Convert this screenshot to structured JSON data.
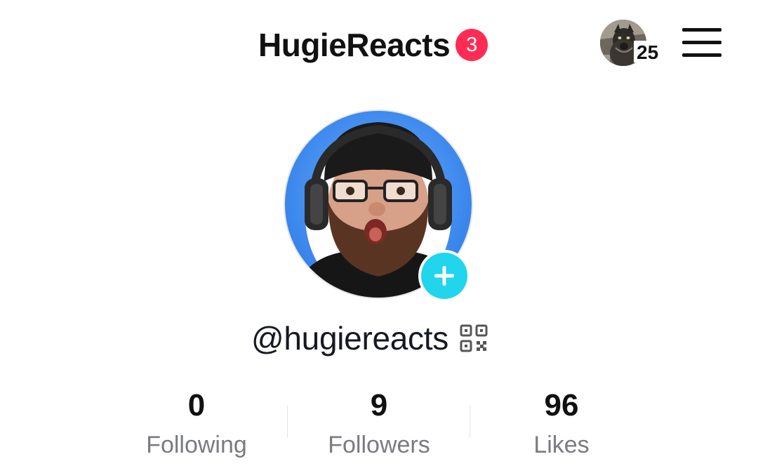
{
  "header": {
    "title": "HugieReacts",
    "notification_count": "3",
    "switch_account_count": "25"
  },
  "icons": {
    "menu": "hamburger-menu-icon",
    "add": "plus-icon",
    "qr": "qr-code-icon"
  },
  "profile": {
    "username": "@hugiereacts"
  },
  "stats": {
    "following_value": "0",
    "following_label": "Following",
    "followers_value": "9",
    "followers_label": "Followers",
    "likes_value": "96",
    "likes_label": "Likes"
  },
  "colors": {
    "badge": "#fe2c55",
    "add_button": "#20d5ec",
    "avatar_bg": "#3d8ef2",
    "secondary_text": "#7a7b80"
  }
}
